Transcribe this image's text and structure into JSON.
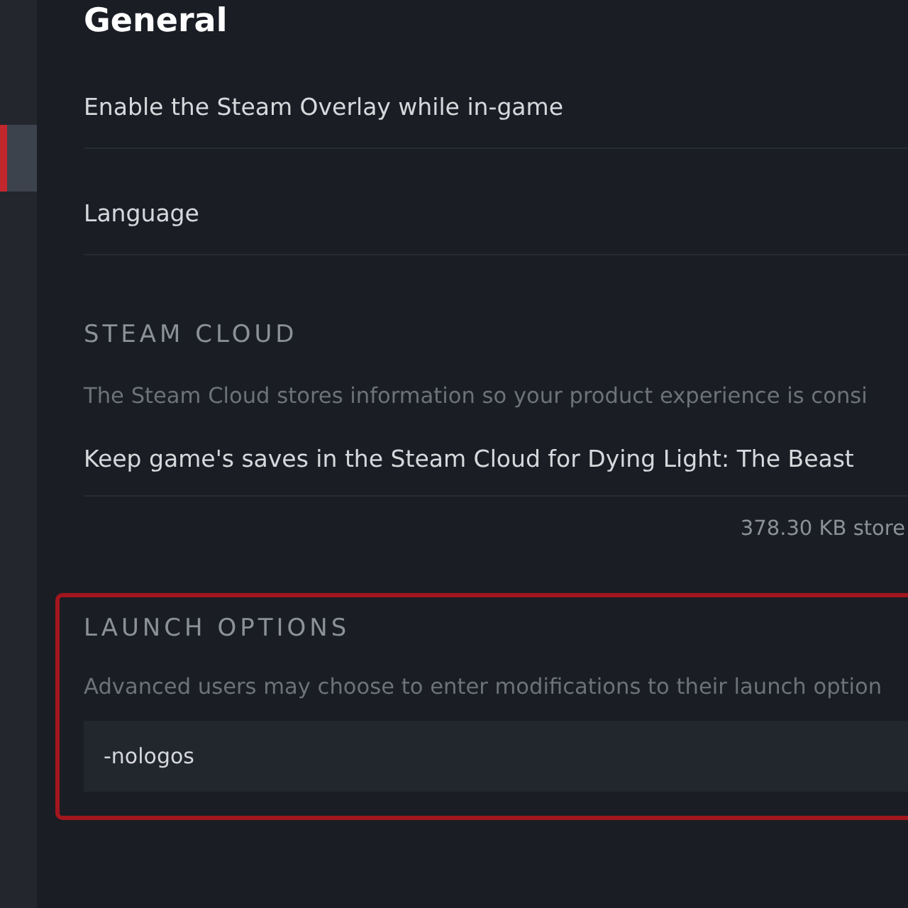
{
  "sidebar": {
    "items": [
      {
        "selected": true
      }
    ]
  },
  "title": "General",
  "settings": [
    {
      "label": "Enable the Steam Overlay while in-game"
    },
    {
      "label": "Language"
    }
  ],
  "steam_cloud": {
    "heading": "STEAM CLOUD",
    "description": "The Steam Cloud stores information so your product experience is consi",
    "option": "Keep game's saves in the Steam Cloud for Dying Light: The Beast",
    "storage": "378.30 KB store"
  },
  "launch_options": {
    "highlighted": true,
    "heading": "LAUNCH OPTIONS",
    "description": "Advanced users may choose to enter modifications to their launch option",
    "value": "-nologos"
  }
}
